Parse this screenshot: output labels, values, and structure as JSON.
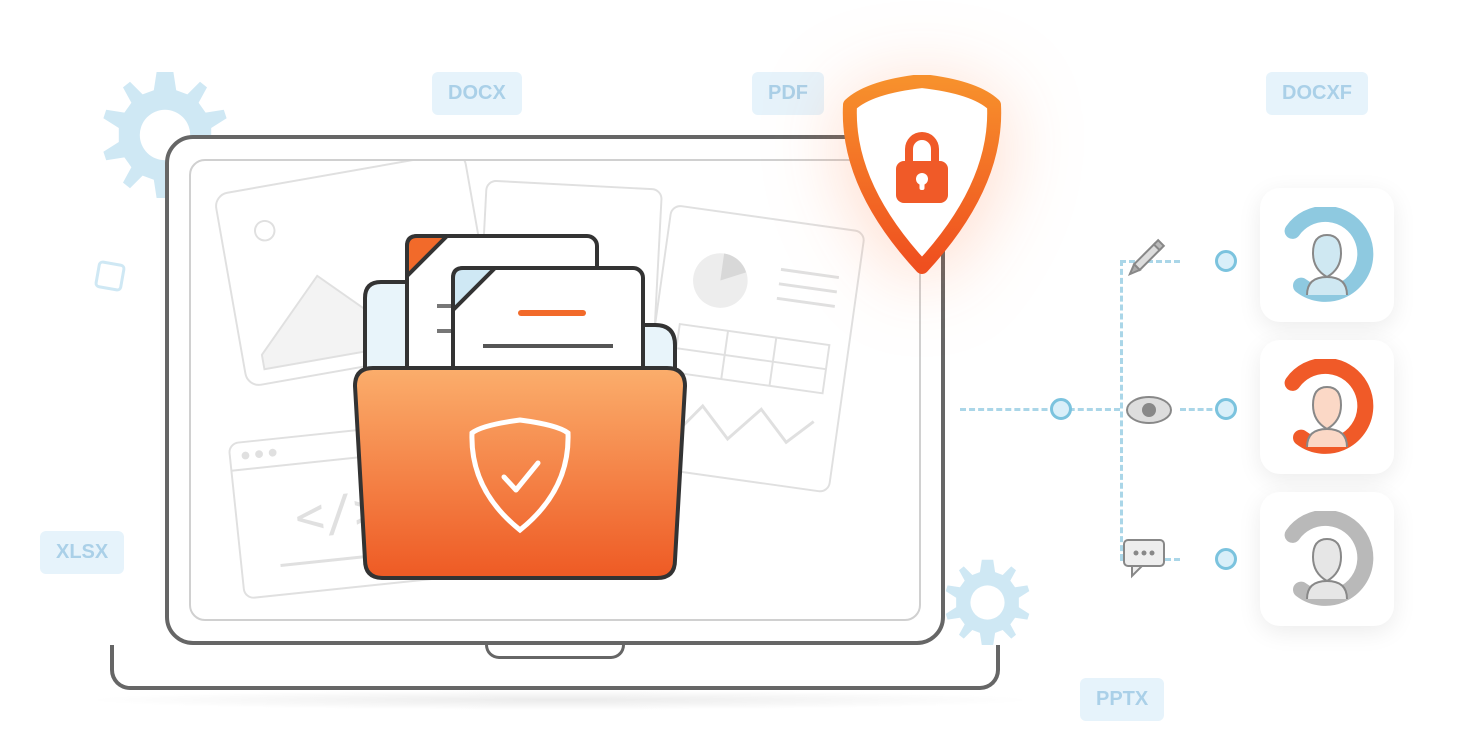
{
  "badges": {
    "docx": "DOCX",
    "pdf": "PDF",
    "docxf": "DOCXF",
    "xlsx": "XLSX",
    "pptx": "PPTX"
  },
  "icons": {
    "gear_big": "gear-icon",
    "gear_small": "gear-icon",
    "shield_lock": "shield-lock-icon",
    "folder_shield": "folder-shield-icon",
    "pencil": "pencil-icon",
    "eye": "eye-icon",
    "comment": "comment-icon",
    "user_blue": "user-avatar",
    "user_orange": "user-avatar",
    "user_gray": "user-avatar"
  },
  "colors": {
    "orange": "#F26A2A",
    "orange_light": "#F79A5C",
    "pale_blue": "#E6F3FB",
    "blue_stroke": "#7BC3DE",
    "gray_stroke": "#666666",
    "light_gray": "#D9D9D9"
  }
}
